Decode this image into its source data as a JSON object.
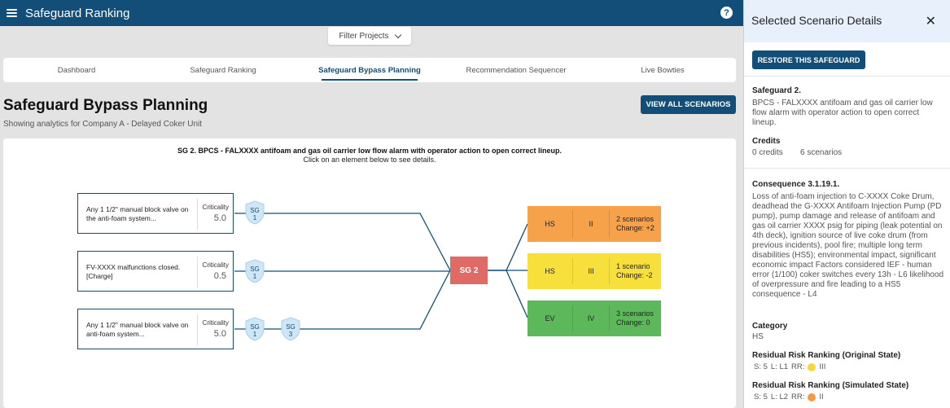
{
  "app": {
    "title": "Safeguard Ranking"
  },
  "filter": {
    "label": "Filter Projects"
  },
  "tabs": [
    {
      "label": "Dashboard"
    },
    {
      "label": "Safeguard Ranking"
    },
    {
      "label": "Safeguard Bypass Planning"
    },
    {
      "label": "Recommendation Sequencer"
    },
    {
      "label": "Live Bowties"
    }
  ],
  "page": {
    "title": "Safeguard Bypass Planning",
    "subtitle": "Showing analytics for Company A - Delayed Coker Unit",
    "view_all_label": "VIEW ALL SCENARIOS"
  },
  "diagram": {
    "title": "SG 2. BPCS - FALXXXX antifoam and gas oil carrier low flow alarm with operator action to open correct lineup.",
    "subtitle": "Click on an element below to see details.",
    "criticality_label": "Criticality",
    "causes": [
      {
        "text": "Any 1 1/2\" manual block valve on the anti-foam system...",
        "criticality": "5.0"
      },
      {
        "text": "FV-XXXX malfunctions closed. [Charge]",
        "criticality": "0.5"
      },
      {
        "text": "Any 1 1/2\" manual block valve on anti-foam system...",
        "criticality": "5.0"
      }
    ],
    "safeguards": [
      {
        "line1": "SG",
        "line2": "1"
      },
      {
        "line1": "SG",
        "line2": "1"
      },
      {
        "line1": "SG",
        "line2": "1"
      },
      {
        "line1": "SG",
        "line2": "3"
      }
    ],
    "center_node": "SG 2",
    "consequences": [
      {
        "category": "HS",
        "level": "II",
        "scenarios": "2 scenarios",
        "change": "Change: +2",
        "color": "#f6a24b"
      },
      {
        "category": "HS",
        "level": "III",
        "scenarios": "1 scenario",
        "change": "Change: -2",
        "color": "#f8e03c"
      },
      {
        "category": "EV",
        "level": "IV",
        "scenarios": "3 scenarios",
        "change": "Change: 0",
        "color": "#5db85c"
      }
    ]
  },
  "side_panel": {
    "title": "Selected Scenario Details",
    "restore_label": "RESTORE THIS SAFEGUARD",
    "safeguard_title": "Safeguard 2.",
    "safeguard_desc": "BPCS - FALXXXX antifoam and gas oil carrier low flow alarm with operator action to open correct lineup.",
    "credits_label": "Credits",
    "credits_value": "0 credits",
    "scenarios_value": "6 scenarios",
    "consequence_title": "Consequence 3.1.19.1.",
    "consequence_desc": "Loss of anti-foam injection to C-XXXX Coke Drum, deadhead the G-XXXX Antifoam Injection Pump (PD pump), pump damage and release of antifoam and gas oil carrier XXXX psig for piping (leak potential on 4th deck), ignition source of live coke drum (from previous incidents), pool fire; multiple long term disabilities (HS5); environmental impact, significant economic impact Factors considered IEF - human error (1/100) coker switches every 13h - L6 likelihood of overpressure and fire leading to a HS5 consequence - L4",
    "category_label": "Category",
    "category_value": "HS",
    "rr_original_label": "Residual Risk Ranking (Original State)",
    "rr_original": {
      "s": "S: 5",
      "l": "L: L1",
      "rr": "RR:",
      "value": "III",
      "dot_color": "#f8d73a"
    },
    "rr_simulated_label": "Residual Risk Ranking (Simulated State)",
    "rr_simulated": {
      "s": "S: 5",
      "l": "L: L2",
      "rr": "RR:",
      "value": "II",
      "dot_color": "#f39a4a"
    }
  }
}
